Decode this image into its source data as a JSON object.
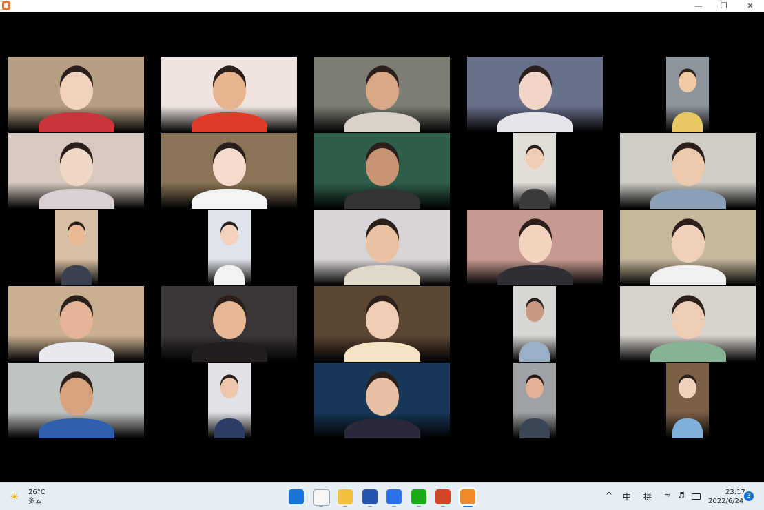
{
  "taskbar": {
    "weather_temp": "26°C",
    "weather_desc": "多云",
    "pinned": [
      {
        "name": "windows-start-icon",
        "color": "#1877d6"
      },
      {
        "name": "file-icon",
        "color": "#f4f6f8"
      },
      {
        "name": "file-explorer-icon",
        "color": "#f2c03a"
      },
      {
        "name": "word-icon",
        "color": "#2557b0"
      },
      {
        "name": "lark-icon",
        "color": "#2b72e8"
      },
      {
        "name": "wechat-icon",
        "color": "#1aad19"
      },
      {
        "name": "powerpoint-icon",
        "color": "#d24726"
      },
      {
        "name": "video-player-icon",
        "color": "#f08a2c"
      }
    ],
    "chevron": "^",
    "ime_lang": "中",
    "ime_mode": "拼",
    "time": "23:17",
    "date": "2022/6/24",
    "notification_count": "3"
  },
  "participants": [
    {
      "bg": "#b79f83",
      "skin": "#f0d2bf",
      "cloth": "#c9353a"
    },
    {
      "bg": "#efe4df",
      "skin": "#e6b48f",
      "cloth": "#e03a2c"
    },
    {
      "bg": "#7d7d74",
      "skin": "#d9a987",
      "cloth": "#d8d2c8"
    },
    {
      "bg": "#68708a",
      "skin": "#f1d6c8",
      "cloth": "#e6e6ea"
    },
    {
      "bg": "#8c949c",
      "skin": "#f0c9a5",
      "cloth": "#e8c860"
    },
    {
      "bg": "#d7c9bf",
      "skin": "#efd7c6",
      "cloth": "#d8d0d0"
    },
    {
      "bg": "#8a7456",
      "skin": "#f3dccb",
      "cloth": "#f4f4f4"
    },
    {
      "bg": "#2f5f4a",
      "skin": "#c89474",
      "cloth": "#333333"
    },
    {
      "bg": "#e3ddd7",
      "skin": "#f0cdb2",
      "cloth": "#3a3a3a"
    },
    {
      "bg": "#cfcdc6",
      "skin": "#edc9ad",
      "cloth": "#8aa0b8"
    },
    {
      "bg": "#d8c0a6",
      "skin": "#e9b995",
      "cloth": "#3a4050"
    },
    {
      "bg": "#dfe3ea",
      "skin": "#f2d2bf",
      "cloth": "#f2f2f2"
    },
    {
      "bg": "#d9d4d8",
      "skin": "#eac2a2",
      "cloth": "#e0d8c8"
    },
    {
      "bg": "#c79a91",
      "skin": "#f3d2bf",
      "cloth": "#2f2f35"
    },
    {
      "bg": "#c5b89b",
      "skin": "#f0d0bb",
      "cloth": "#f0f0f0"
    },
    {
      "bg": "#c8b090",
      "skin": "#e4b496",
      "cloth": "#e8e8ee"
    },
    {
      "bg": "#3a3536",
      "skin": "#e6b895",
      "cloth": "#221e1e"
    },
    {
      "bg": "#5c4634",
      "skin": "#f1cdb4",
      "cloth": "#f5e4c4"
    },
    {
      "bg": "#d7d6d2",
      "skin": "#c99a82",
      "cloth": "#9ab0c6"
    },
    {
      "bg": "#d8d2cc",
      "skin": "#efcdb5",
      "cloth": "#86b394"
    },
    {
      "bg": "#bfc3c2",
      "skin": "#d8a27f",
      "cloth": "#2f5fae"
    },
    {
      "bg": "#e2e1e8",
      "skin": "#eec6a9",
      "cloth": "#2c3e66"
    },
    {
      "bg": "#18385a",
      "skin": "#eac0a5",
      "cloth": "#2a2a3a"
    },
    {
      "bg": "#9fa3a8",
      "skin": "#e3b194",
      "cloth": "#3a4656"
    },
    {
      "bg": "#7b5f47",
      "skin": "#f1d1bd",
      "cloth": "#7fb0d9"
    }
  ]
}
